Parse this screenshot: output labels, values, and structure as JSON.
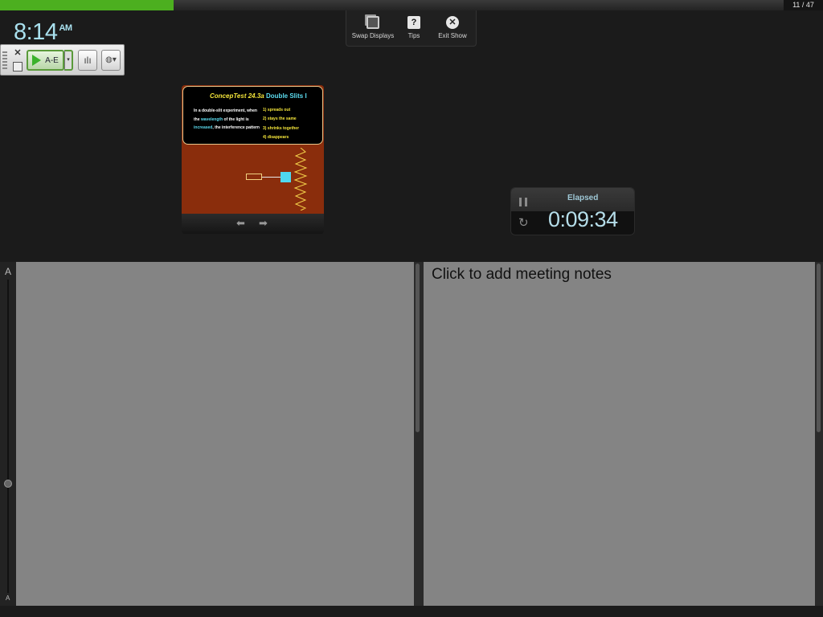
{
  "progress": {
    "current": 11,
    "total": 47,
    "label": "11 / 47",
    "fill_fraction": 0.222,
    "color": "#4caf1f"
  },
  "clock": {
    "time": "8:14",
    "ampm": "AM"
  },
  "toolbar": {
    "close_icon": "close-icon",
    "copy_icon": "copy-icon",
    "play_label": "A-E",
    "dropdown_glyph": "▾",
    "chart_glyph": "ılı",
    "globe_glyph": "◍▾"
  },
  "top_menu": [
    {
      "label": "Swap Displays",
      "icon": "swap-displays-icon"
    },
    {
      "label": "Tips",
      "icon": "tips-icon",
      "glyph": "?"
    },
    {
      "label": "Exit Show",
      "icon": "exit-icon",
      "glyph": "✕"
    }
  ],
  "slide": {
    "title_left": "ConcepTest 24.3a",
    "title_right": "Double Slits I",
    "question_parts": [
      "In a double-slit experiment, when the ",
      "wavelength",
      " of the light is ",
      "increased",
      ", the interference pattern"
    ],
    "answers": [
      "1) spreads out",
      "2) stays the same",
      "3) shrinks together",
      "4) disappears"
    ],
    "prev_glyph": "⬅",
    "next_glyph": "➡"
  },
  "timer": {
    "label": "Elapsed",
    "value": "0:09:34",
    "reset_glyph": "↻"
  },
  "font_size_control": {
    "large_label": "A",
    "small_label": "A"
  },
  "notes": {
    "placeholder": "Click to add meeting notes"
  }
}
